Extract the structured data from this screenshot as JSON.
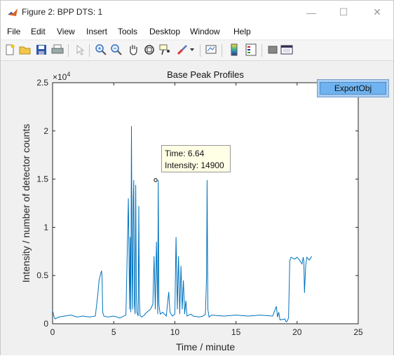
{
  "window": {
    "title": "Figure 2: BPP DTS: 1",
    "controls": {
      "minimize": "—",
      "maximize": "☐",
      "close": "✕"
    }
  },
  "menubar": {
    "items": [
      "File",
      "Edit",
      "View",
      "Insert",
      "Tools",
      "Desktop",
      "Window",
      "Help"
    ]
  },
  "toolbar": {
    "icons": [
      "new-figure-icon",
      "open-file-icon",
      "save-icon",
      "print-icon",
      "edit-plot-icon",
      "zoom-in-icon",
      "zoom-out-icon",
      "pan-icon",
      "rotate-3d-icon",
      "data-cursor-icon",
      "brush-icon",
      "brush-dropdown-icon",
      "link-plot-icon",
      "insert-colorbar-icon",
      "insert-legend-icon",
      "hide-plot-tools-icon",
      "show-plot-tools-icon"
    ]
  },
  "button": {
    "label": "ExportObj"
  },
  "datatip": {
    "time_line": "Time: 6.64",
    "intensity_line": "Intensity: 14900"
  },
  "chart_data": {
    "type": "line",
    "title": "Base Peak Profiles",
    "xlabel": "Time / minute",
    "ylabel": "Intensity / number of detector counts",
    "exponent_label": "× 10^4",
    "xlim": [
      0,
      25
    ],
    "ylim": [
      0,
      25000
    ],
    "x_ticks": [
      0,
      5,
      10,
      15,
      20,
      25
    ],
    "x_tick_labels": [
      "0",
      "5",
      "10",
      "15",
      "20",
      "25"
    ],
    "y_ticks": [
      0,
      5000,
      10000,
      15000,
      20000,
      25000
    ],
    "y_tick_labels": [
      "0",
      "0.5",
      "1",
      "1.5",
      "2",
      "2.5"
    ],
    "grid": false,
    "line_color": "#0072bd",
    "x": [
      0,
      0.1,
      0.2,
      0.5,
      1,
      1.5,
      2,
      2.5,
      3,
      3.5,
      3.7,
      3.8,
      3.9,
      4.0,
      4.05,
      4.1,
      4.2,
      4.5,
      5,
      5.5,
      6.0,
      6.2,
      6.3,
      6.35,
      6.4,
      6.45,
      6.5,
      6.55,
      6.6,
      6.64,
      6.7,
      6.75,
      6.8,
      6.85,
      6.9,
      7.0,
      7.05,
      7.1,
      7.15,
      7.2,
      7.3,
      7.4,
      7.5,
      7.7,
      8.0,
      8.2,
      8.3,
      8.4,
      8.5,
      8.6,
      8.64,
      8.7,
      8.8,
      9.0,
      9.3,
      9.5,
      9.6,
      9.8,
      10.0,
      10.1,
      10.2,
      10.3,
      10.4,
      10.5,
      10.6,
      10.7,
      10.8,
      10.9,
      11.0,
      11.3,
      11.5,
      12.0,
      12.3,
      12.5,
      12.6,
      12.64,
      12.7,
      12.8,
      13,
      14,
      15,
      16,
      17,
      18,
      18.3,
      18.4,
      18.5,
      18.6,
      19.0,
      19.1,
      19.2,
      19.3,
      19.4,
      19.5,
      19.8,
      20.0,
      20.2,
      20.4,
      20.5,
      20.55,
      20.6,
      20.7,
      20.8,
      21.0,
      21.2
    ],
    "y": [
      1400,
      800,
      500,
      700,
      800,
      900,
      700,
      800,
      700,
      800,
      3000,
      4500,
      5000,
      5500,
      4800,
      1200,
      800,
      700,
      800,
      600,
      900,
      13000,
      1500,
      9000,
      1200,
      20500,
      6000,
      1500,
      12800,
      14900,
      2000,
      1000,
      14400,
      3000,
      1200,
      800,
      12200,
      2500,
      900,
      800,
      700,
      800,
      900,
      1200,
      1500,
      2000,
      7000,
      1500,
      8500,
      1000,
      14900,
      2000,
      1000,
      1200,
      800,
      3300,
      1200,
      800,
      1000,
      9000,
      1500,
      7000,
      1000,
      6000,
      1500,
      4500,
      1000,
      2400,
      800,
      1000,
      800,
      700,
      800,
      1000,
      5000,
      14900,
      1500,
      700,
      900,
      800,
      900,
      800,
      900,
      800,
      1800,
      700,
      1200,
      400,
      500,
      200,
      300,
      600,
      6500,
      6900,
      6700,
      6900,
      6600,
      6200,
      6900,
      6500,
      3200,
      6000,
      6900,
      6600,
      7000
    ]
  }
}
